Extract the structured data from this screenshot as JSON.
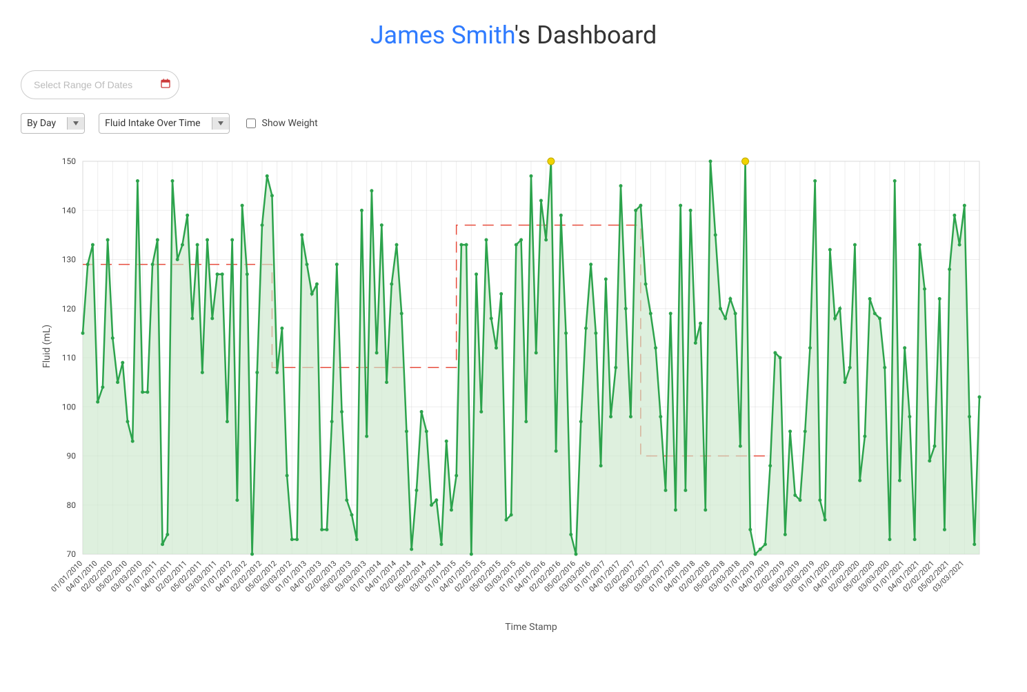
{
  "header": {
    "user_name": "James Smith",
    "title_suffix": "'s Dashboard"
  },
  "controls": {
    "date_placeholder": "Select Range Of Dates",
    "group_by_value": "By Day",
    "metric_value": "Fluid Intake Over Time",
    "show_weight_label": "Show Weight"
  },
  "chart_data": {
    "type": "line",
    "ylabel": "Fluid (mL)",
    "xlabel": "Time Stamp",
    "ylim": [
      70,
      150
    ],
    "y_ticks": [
      70,
      80,
      90,
      100,
      110,
      120,
      130,
      140,
      150
    ],
    "reference_lines": [
      {
        "from_idx": 0,
        "to_idx": 38,
        "value": 129
      },
      {
        "from_idx": 38,
        "to_idx": 75,
        "value": 108
      },
      {
        "from_idx": 75,
        "to_idx": 112,
        "value": 137
      },
      {
        "from_idx": 112,
        "to_idx": 138,
        "value": 90
      }
    ],
    "x_labels": [
      "01/01/2010",
      "04/01/2010",
      "02/02/2010",
      "05/02/2010",
      "03/03/2010",
      "01/01/2011",
      "04/01/2011",
      "02/02/2011",
      "05/02/2011",
      "03/03/2011",
      "01/01/2012",
      "04/01/2012",
      "02/02/2012",
      "05/02/2012",
      "03/03/2012",
      "01/01/2013",
      "04/01/2013",
      "02/02/2013",
      "05/02/2013",
      "03/03/2013",
      "01/01/2014",
      "04/01/2014",
      "02/02/2014",
      "05/02/2014",
      "03/03/2014",
      "01/01/2015",
      "04/01/2015",
      "02/02/2015",
      "05/02/2015",
      "03/03/2015",
      "01/01/2016",
      "04/01/2016",
      "02/02/2016",
      "05/02/2016",
      "03/03/2016",
      "01/01/2017",
      "04/01/2017",
      "02/02/2017",
      "05/02/2017",
      "03/03/2017",
      "01/01/2018",
      "04/01/2018",
      "02/02/2018",
      "05/02/2018",
      "03/03/2018",
      "01/01/2019",
      "04/01/2019",
      "02/02/2019",
      "05/02/2019",
      "03/03/2019",
      "01/01/2020",
      "04/01/2020",
      "02/02/2020",
      "05/02/2020",
      "03/03/2020",
      "01/01/2021",
      "04/01/2021",
      "02/02/2021",
      "05/02/2021",
      "03/03/2021"
    ],
    "series": [
      {
        "name": "Fluid Intake",
        "values": [
          115,
          129,
          133,
          101,
          104,
          134,
          114,
          105,
          109,
          97,
          93,
          146,
          103,
          103,
          129,
          134,
          72,
          74,
          146,
          130,
          133,
          139,
          118,
          133,
          107,
          134,
          118,
          127,
          127,
          97,
          134,
          81,
          141,
          127,
          70,
          107,
          137,
          147,
          143,
          107,
          116,
          86,
          73,
          73,
          135,
          129,
          123,
          125,
          75,
          75,
          97,
          129,
          99,
          81,
          78,
          73,
          140,
          94,
          144,
          111,
          137,
          105,
          125,
          133,
          119,
          95,
          71,
          83,
          99,
          95,
          80,
          81,
          72,
          93,
          79,
          86,
          133,
          133,
          70,
          127,
          99,
          134,
          118,
          112,
          123,
          77,
          78,
          133,
          134,
          97,
          147,
          111,
          142,
          134,
          150,
          91,
          139,
          115,
          74,
          70,
          97,
          116,
          129,
          115,
          88,
          126,
          98,
          108,
          145,
          120,
          98,
          140,
          141,
          125,
          119,
          112,
          98,
          83,
          119,
          79,
          141,
          83,
          140,
          113,
          117,
          79,
          150,
          135,
          120,
          118,
          122,
          119,
          92,
          150,
          75,
          70,
          71,
          72,
          88,
          111,
          110,
          74,
          95,
          82,
          81,
          95,
          112,
          146,
          81,
          77,
          132,
          118,
          120,
          105,
          108,
          133,
          85,
          94,
          122,
          119,
          118,
          108,
          73,
          146,
          85,
          112,
          98,
          73,
          133,
          124,
          89,
          92,
          122,
          75,
          128,
          139,
          133,
          141,
          98,
          72,
          102
        ]
      }
    ],
    "highlight_points": [
      94,
      133
    ]
  }
}
